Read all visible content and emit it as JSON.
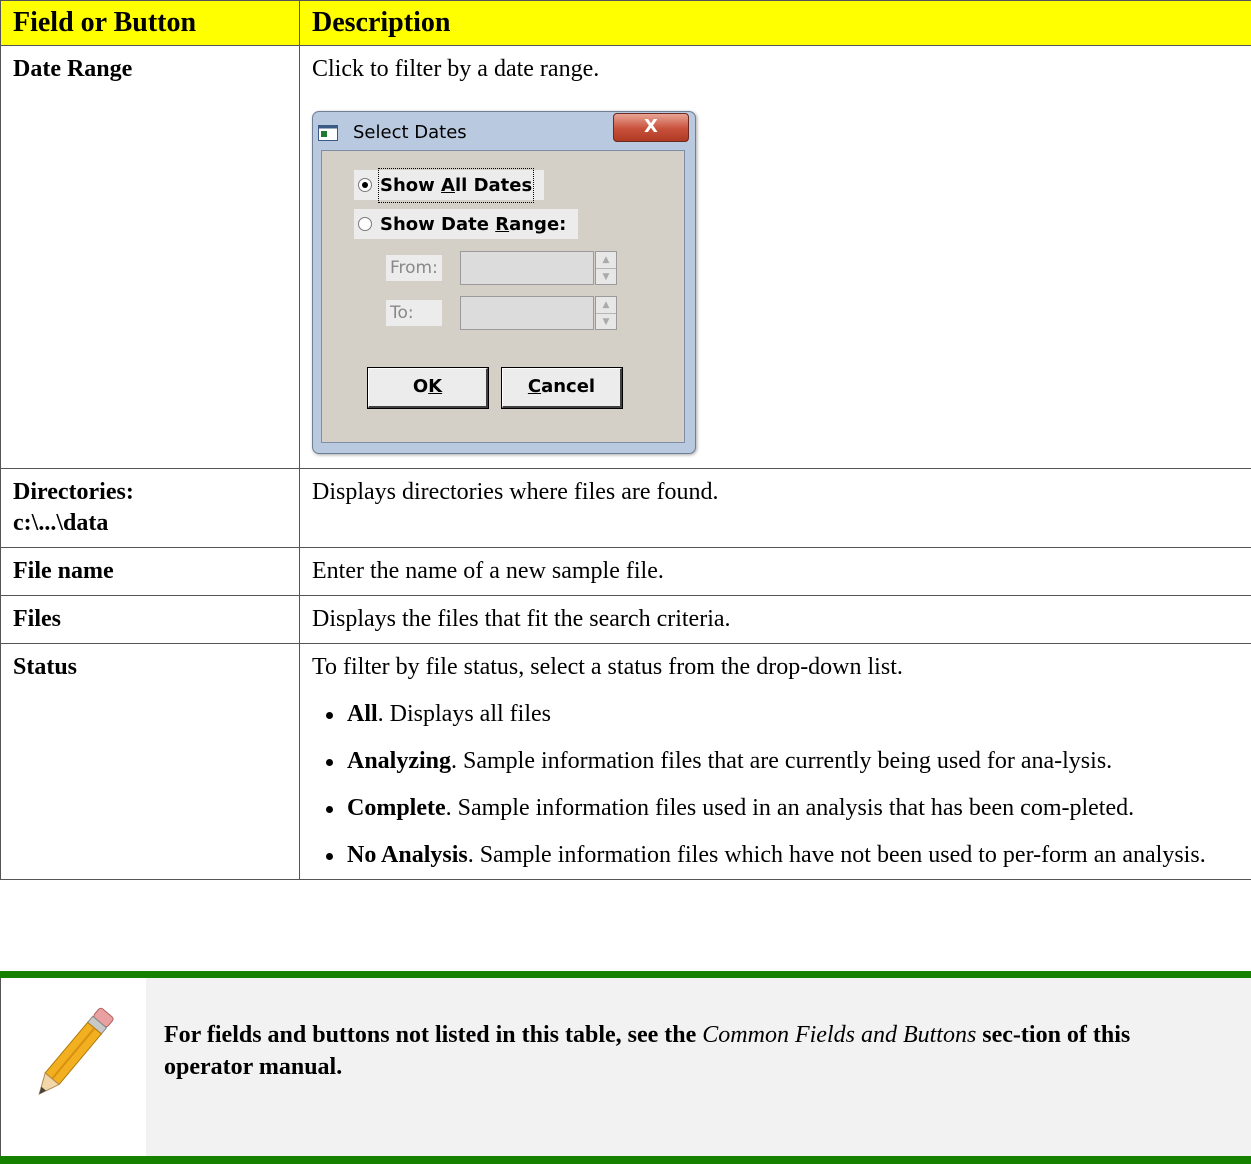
{
  "table": {
    "header": {
      "field": "Field or Button",
      "description": "Description"
    },
    "rows": {
      "date_range": {
        "field": "Date Range",
        "description": "Click to filter by a date range."
      },
      "directories": {
        "field_line1": "Directories:",
        "field_line2": "c:\\...\\data",
        "description": "Displays directories where files are found."
      },
      "file_name": {
        "field": "File name",
        "description": "Enter the name of a new sample file."
      },
      "files": {
        "field": "Files",
        "description": "Displays the files that fit the search criteria."
      },
      "status": {
        "field": "Status",
        "description": "To filter by file status, select a status from the drop-down list.",
        "bullets": [
          {
            "term": "All",
            "text": ". Displays all files"
          },
          {
            "term": "Analyzing",
            "text": ". Sample information files that are currently being used for ana-lysis."
          },
          {
            "term": "Complete",
            "text": ". Sample information files used in an analysis that has been com-pleted."
          },
          {
            "term": "No Analysis",
            "text": ". Sample information files which have not been used to per-form an analysis."
          }
        ]
      }
    }
  },
  "dialog": {
    "title": "Select Dates",
    "close_label": "X",
    "radio_all": {
      "pre": "Show ",
      "underlined": "A",
      "post": "ll Dates",
      "selected": true
    },
    "radio_range": {
      "pre": "Show Date ",
      "underlined": "R",
      "post": "ange:",
      "selected": false
    },
    "from_label": "From:",
    "to_label": "To:",
    "from_value": "",
    "to_value": "",
    "ok": {
      "pre": "O",
      "underlined": "K",
      "post": ""
    },
    "cancel": {
      "pre": "",
      "underlined": "C",
      "post": "ancel"
    }
  },
  "note": {
    "text_before": "For fields and buttons not listed in this table, see the ",
    "text_italic": "Common Fields and Buttons",
    "text_after": " sec-tion of this operator manual."
  }
}
